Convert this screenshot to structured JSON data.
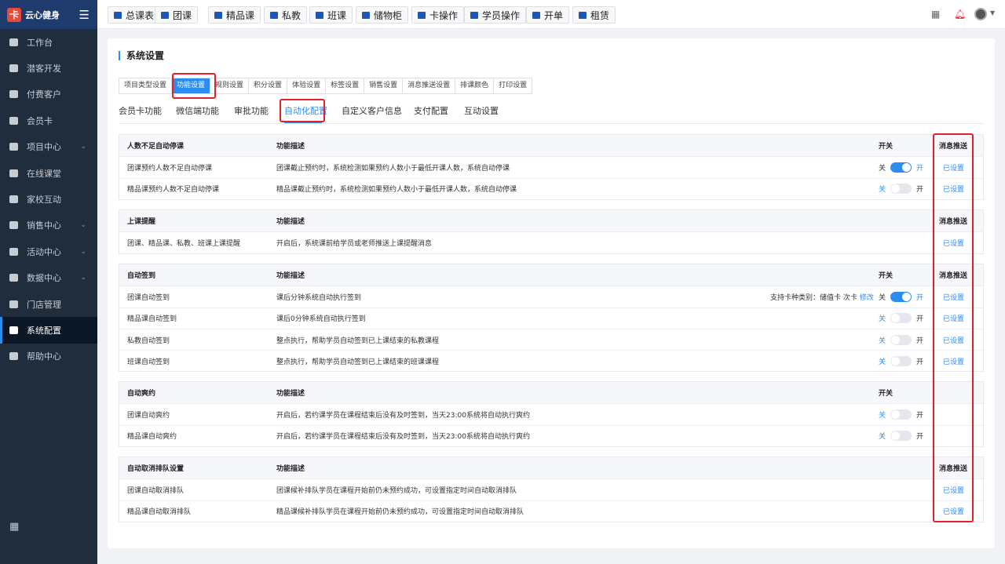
{
  "app": {
    "name": "云心健身"
  },
  "sidebar": {
    "items": [
      {
        "label": "工作台",
        "icon": "monitor-icon",
        "expandable": false,
        "active": false
      },
      {
        "label": "潜客开发",
        "icon": "id-card-icon",
        "expandable": false,
        "active": false
      },
      {
        "label": "付费客户",
        "icon": "users-icon",
        "expandable": false,
        "active": false
      },
      {
        "label": "会员卡",
        "icon": "card-icon",
        "expandable": false,
        "active": false
      },
      {
        "label": "项目中心",
        "icon": "folder-icon",
        "expandable": true,
        "active": false
      },
      {
        "label": "在线课堂",
        "icon": "video-icon",
        "expandable": false,
        "active": false
      },
      {
        "label": "家校互动",
        "icon": "chat-icon",
        "expandable": false,
        "active": false
      },
      {
        "label": "销售中心",
        "icon": "tag-icon",
        "expandable": true,
        "active": false
      },
      {
        "label": "活动中心",
        "icon": "calendar-icon",
        "expandable": true,
        "active": false
      },
      {
        "label": "数据中心",
        "icon": "chart-icon",
        "expandable": true,
        "active": false
      },
      {
        "label": "门店管理",
        "icon": "store-icon",
        "expandable": false,
        "active": false
      },
      {
        "label": "系统配置",
        "icon": "settings-icon",
        "expandable": false,
        "active": true
      },
      {
        "label": "帮助中心",
        "icon": "help-icon",
        "expandable": false,
        "active": false
      }
    ]
  },
  "topbar": {
    "buttons": [
      {
        "label": "总课表",
        "icon": "book-icon"
      },
      {
        "label": "团课",
        "icon": "book-icon"
      },
      {
        "label": "精品课",
        "icon": "book-icon"
      },
      {
        "label": "私教",
        "icon": "users-icon"
      },
      {
        "label": "班课",
        "icon": "monitor-icon"
      },
      {
        "label": "储物柜",
        "icon": "locker-icon"
      },
      {
        "label": "卡操作",
        "icon": "card-icon"
      },
      {
        "label": "学员操作",
        "icon": "user-icon"
      },
      {
        "label": "开单",
        "icon": "receipt-icon"
      },
      {
        "label": "租赁",
        "icon": "building-icon"
      }
    ]
  },
  "page": {
    "title": "系统设置",
    "tabs": [
      "项目类型设置",
      "功能设置",
      "规则设置",
      "积分设置",
      "体验设置",
      "标签设置",
      "销售设置",
      "消息推送设置",
      "排课颜色",
      "打印设置"
    ],
    "active_tab": "功能设置",
    "subtabs": [
      "会员卡功能",
      "微信端功能",
      "审批功能",
      "自动化配置",
      "自定义客户信息",
      "支付配置",
      "互动设置"
    ],
    "active_subtab": "自动化配置"
  },
  "labels": {
    "desc": "功能描述",
    "switch": "开关",
    "push": "消息推送",
    "off": "关",
    "on": "开",
    "configured": "已设置",
    "edit": "修改"
  },
  "sections": [
    {
      "title": "人数不足自动停课",
      "rows": [
        {
          "name": "团课预约人数不足自动停课",
          "desc": "团课截止预约时，系统检测如果预约人数小于最低开课人数，系统自动停课",
          "enabled": true
        },
        {
          "name": "精品课预约人数不足自动停课",
          "desc": "精品课截止预约时，系统检测如果预约人数小于最低开课人数，系统自动停课",
          "enabled": false
        }
      ]
    },
    {
      "title": "上课提醒",
      "rows": [
        {
          "name": "团课、精品课、私教、班课上课提醒",
          "desc": "开启后，系统课前给学员或老师推送上课提醒消息"
        }
      ]
    },
    {
      "title": "自动签到",
      "rows": [
        {
          "name": "团课自动签到",
          "desc": "课后分钟系统自动执行签到",
          "support": "支持卡种类别：储值卡 次卡",
          "enabled": true
        },
        {
          "name": "精品课自动签到",
          "desc": "课后0分钟系统自动执行签到",
          "enabled": false
        },
        {
          "name": "私教自动签到",
          "desc": "整点执行，帮助学员自动签到已上课结束的私教课程",
          "enabled": false
        },
        {
          "name": "班课自动签到",
          "desc": "整点执行，帮助学员自动签到已上课结束的班课课程",
          "enabled": false
        }
      ]
    },
    {
      "title": "自动爽约",
      "rows": [
        {
          "name": "团课自动爽约",
          "desc": "开启后，若约课学员在课程结束后没有及时签到，当天23:00系统将自动执行爽约",
          "enabled": false
        },
        {
          "name": "精品课自动爽约",
          "desc": "开启后，若约课学员在课程结束后没有及时签到，当天23:00系统将自动执行爽约",
          "enabled": false
        }
      ]
    },
    {
      "title": "自动取消排队设置",
      "rows": [
        {
          "name": "团课自动取消排队",
          "desc": "团课候补排队学员在课程开始前仍未预约成功，可设置指定时间自动取消排队"
        },
        {
          "name": "精品课自动取消排队",
          "desc": "精品课候补排队学员在课程开始前仍未预约成功，可设置指定时间自动取消排队"
        }
      ]
    }
  ]
}
